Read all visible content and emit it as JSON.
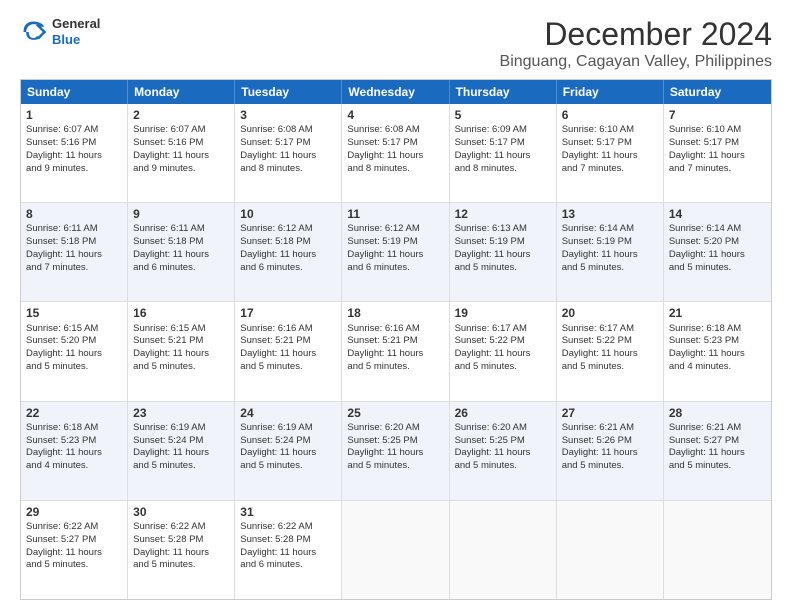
{
  "logo": {
    "line1": "General",
    "line2": "Blue"
  },
  "title": "December 2024",
  "subtitle": "Binguang, Cagayan Valley, Philippines",
  "days": [
    "Sunday",
    "Monday",
    "Tuesday",
    "Wednesday",
    "Thursday",
    "Friday",
    "Saturday"
  ],
  "weeks": [
    [
      {
        "num": "1",
        "rise": "6:07 AM",
        "set": "5:16 PM",
        "daylight": "11 hours and 9 minutes."
      },
      {
        "num": "2",
        "rise": "6:07 AM",
        "set": "5:16 PM",
        "daylight": "11 hours and 9 minutes."
      },
      {
        "num": "3",
        "rise": "6:08 AM",
        "set": "5:17 PM",
        "daylight": "11 hours and 8 minutes."
      },
      {
        "num": "4",
        "rise": "6:08 AM",
        "set": "5:17 PM",
        "daylight": "11 hours and 8 minutes."
      },
      {
        "num": "5",
        "rise": "6:09 AM",
        "set": "5:17 PM",
        "daylight": "11 hours and 8 minutes."
      },
      {
        "num": "6",
        "rise": "6:10 AM",
        "set": "5:17 PM",
        "daylight": "11 hours and 7 minutes."
      },
      {
        "num": "7",
        "rise": "6:10 AM",
        "set": "5:17 PM",
        "daylight": "11 hours and 7 minutes."
      }
    ],
    [
      {
        "num": "8",
        "rise": "6:11 AM",
        "set": "5:18 PM",
        "daylight": "11 hours and 7 minutes."
      },
      {
        "num": "9",
        "rise": "6:11 AM",
        "set": "5:18 PM",
        "daylight": "11 hours and 6 minutes."
      },
      {
        "num": "10",
        "rise": "6:12 AM",
        "set": "5:18 PM",
        "daylight": "11 hours and 6 minutes."
      },
      {
        "num": "11",
        "rise": "6:12 AM",
        "set": "5:19 PM",
        "daylight": "11 hours and 6 minutes."
      },
      {
        "num": "12",
        "rise": "6:13 AM",
        "set": "5:19 PM",
        "daylight": "11 hours and 5 minutes."
      },
      {
        "num": "13",
        "rise": "6:14 AM",
        "set": "5:19 PM",
        "daylight": "11 hours and 5 minutes."
      },
      {
        "num": "14",
        "rise": "6:14 AM",
        "set": "5:20 PM",
        "daylight": "11 hours and 5 minutes."
      }
    ],
    [
      {
        "num": "15",
        "rise": "6:15 AM",
        "set": "5:20 PM",
        "daylight": "11 hours and 5 minutes."
      },
      {
        "num": "16",
        "rise": "6:15 AM",
        "set": "5:21 PM",
        "daylight": "11 hours and 5 minutes."
      },
      {
        "num": "17",
        "rise": "6:16 AM",
        "set": "5:21 PM",
        "daylight": "11 hours and 5 minutes."
      },
      {
        "num": "18",
        "rise": "6:16 AM",
        "set": "5:21 PM",
        "daylight": "11 hours and 5 minutes."
      },
      {
        "num": "19",
        "rise": "6:17 AM",
        "set": "5:22 PM",
        "daylight": "11 hours and 5 minutes."
      },
      {
        "num": "20",
        "rise": "6:17 AM",
        "set": "5:22 PM",
        "daylight": "11 hours and 5 minutes."
      },
      {
        "num": "21",
        "rise": "6:18 AM",
        "set": "5:23 PM",
        "daylight": "11 hours and 4 minutes."
      }
    ],
    [
      {
        "num": "22",
        "rise": "6:18 AM",
        "set": "5:23 PM",
        "daylight": "11 hours and 4 minutes."
      },
      {
        "num": "23",
        "rise": "6:19 AM",
        "set": "5:24 PM",
        "daylight": "11 hours and 5 minutes."
      },
      {
        "num": "24",
        "rise": "6:19 AM",
        "set": "5:24 PM",
        "daylight": "11 hours and 5 minutes."
      },
      {
        "num": "25",
        "rise": "6:20 AM",
        "set": "5:25 PM",
        "daylight": "11 hours and 5 minutes."
      },
      {
        "num": "26",
        "rise": "6:20 AM",
        "set": "5:25 PM",
        "daylight": "11 hours and 5 minutes."
      },
      {
        "num": "27",
        "rise": "6:21 AM",
        "set": "5:26 PM",
        "daylight": "11 hours and 5 minutes."
      },
      {
        "num": "28",
        "rise": "6:21 AM",
        "set": "5:27 PM",
        "daylight": "11 hours and 5 minutes."
      }
    ],
    [
      {
        "num": "29",
        "rise": "6:22 AM",
        "set": "5:27 PM",
        "daylight": "11 hours and 5 minutes."
      },
      {
        "num": "30",
        "rise": "6:22 AM",
        "set": "5:28 PM",
        "daylight": "11 hours and 5 minutes."
      },
      {
        "num": "31",
        "rise": "6:22 AM",
        "set": "5:28 PM",
        "daylight": "11 hours and 6 minutes."
      },
      null,
      null,
      null,
      null
    ]
  ],
  "labels": {
    "sunrise": "Sunrise:",
    "sunset": "Sunset:",
    "daylight": "Daylight:"
  }
}
